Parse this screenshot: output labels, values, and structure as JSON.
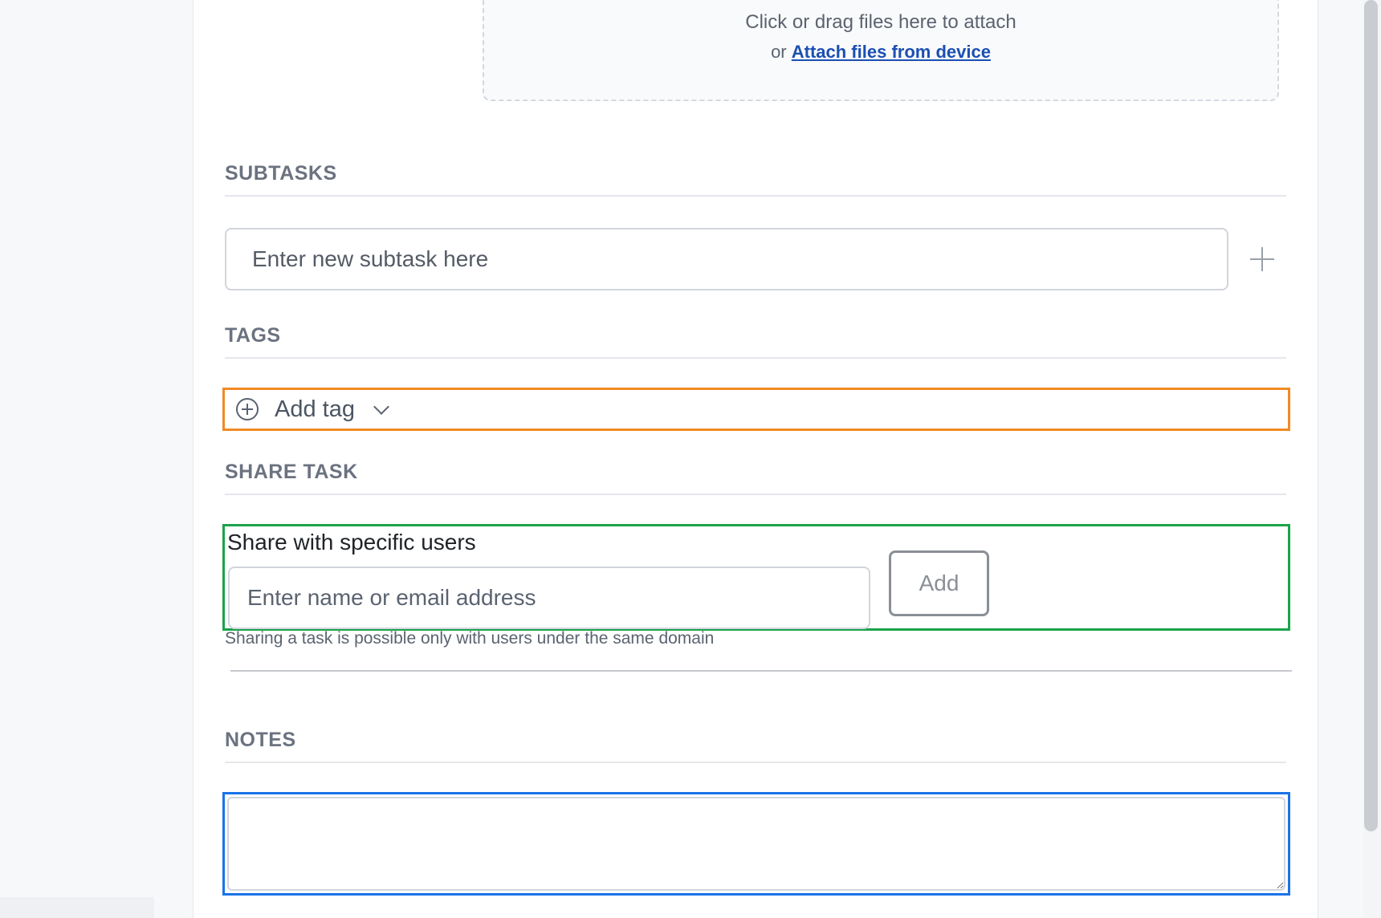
{
  "attachments": {
    "dropzone_title": "Click or drag files here to attach",
    "dropzone_or": "or",
    "dropzone_link": "Attach files from device"
  },
  "subtasks": {
    "heading": "SUBTASKS",
    "input_placeholder": "Enter new subtask here",
    "add_icon": "plus-icon"
  },
  "tags": {
    "heading": "TAGS",
    "add_label": "Add tag",
    "add_icon": "plus-circle-icon",
    "dropdown_icon": "chevron-down-icon"
  },
  "share": {
    "heading": "SHARE TASK",
    "label": "Share with specific users",
    "input_placeholder": "Enter name or email address",
    "add_button": "Add",
    "hint": "Sharing a task is possible only with users under the same domain"
  },
  "notes": {
    "heading": "NOTES",
    "value": ""
  },
  "colors": {
    "tag_highlight": "#f08a24",
    "share_highlight": "#1aa34a",
    "notes_highlight": "#1a73e8",
    "link": "#1b4fb3"
  }
}
